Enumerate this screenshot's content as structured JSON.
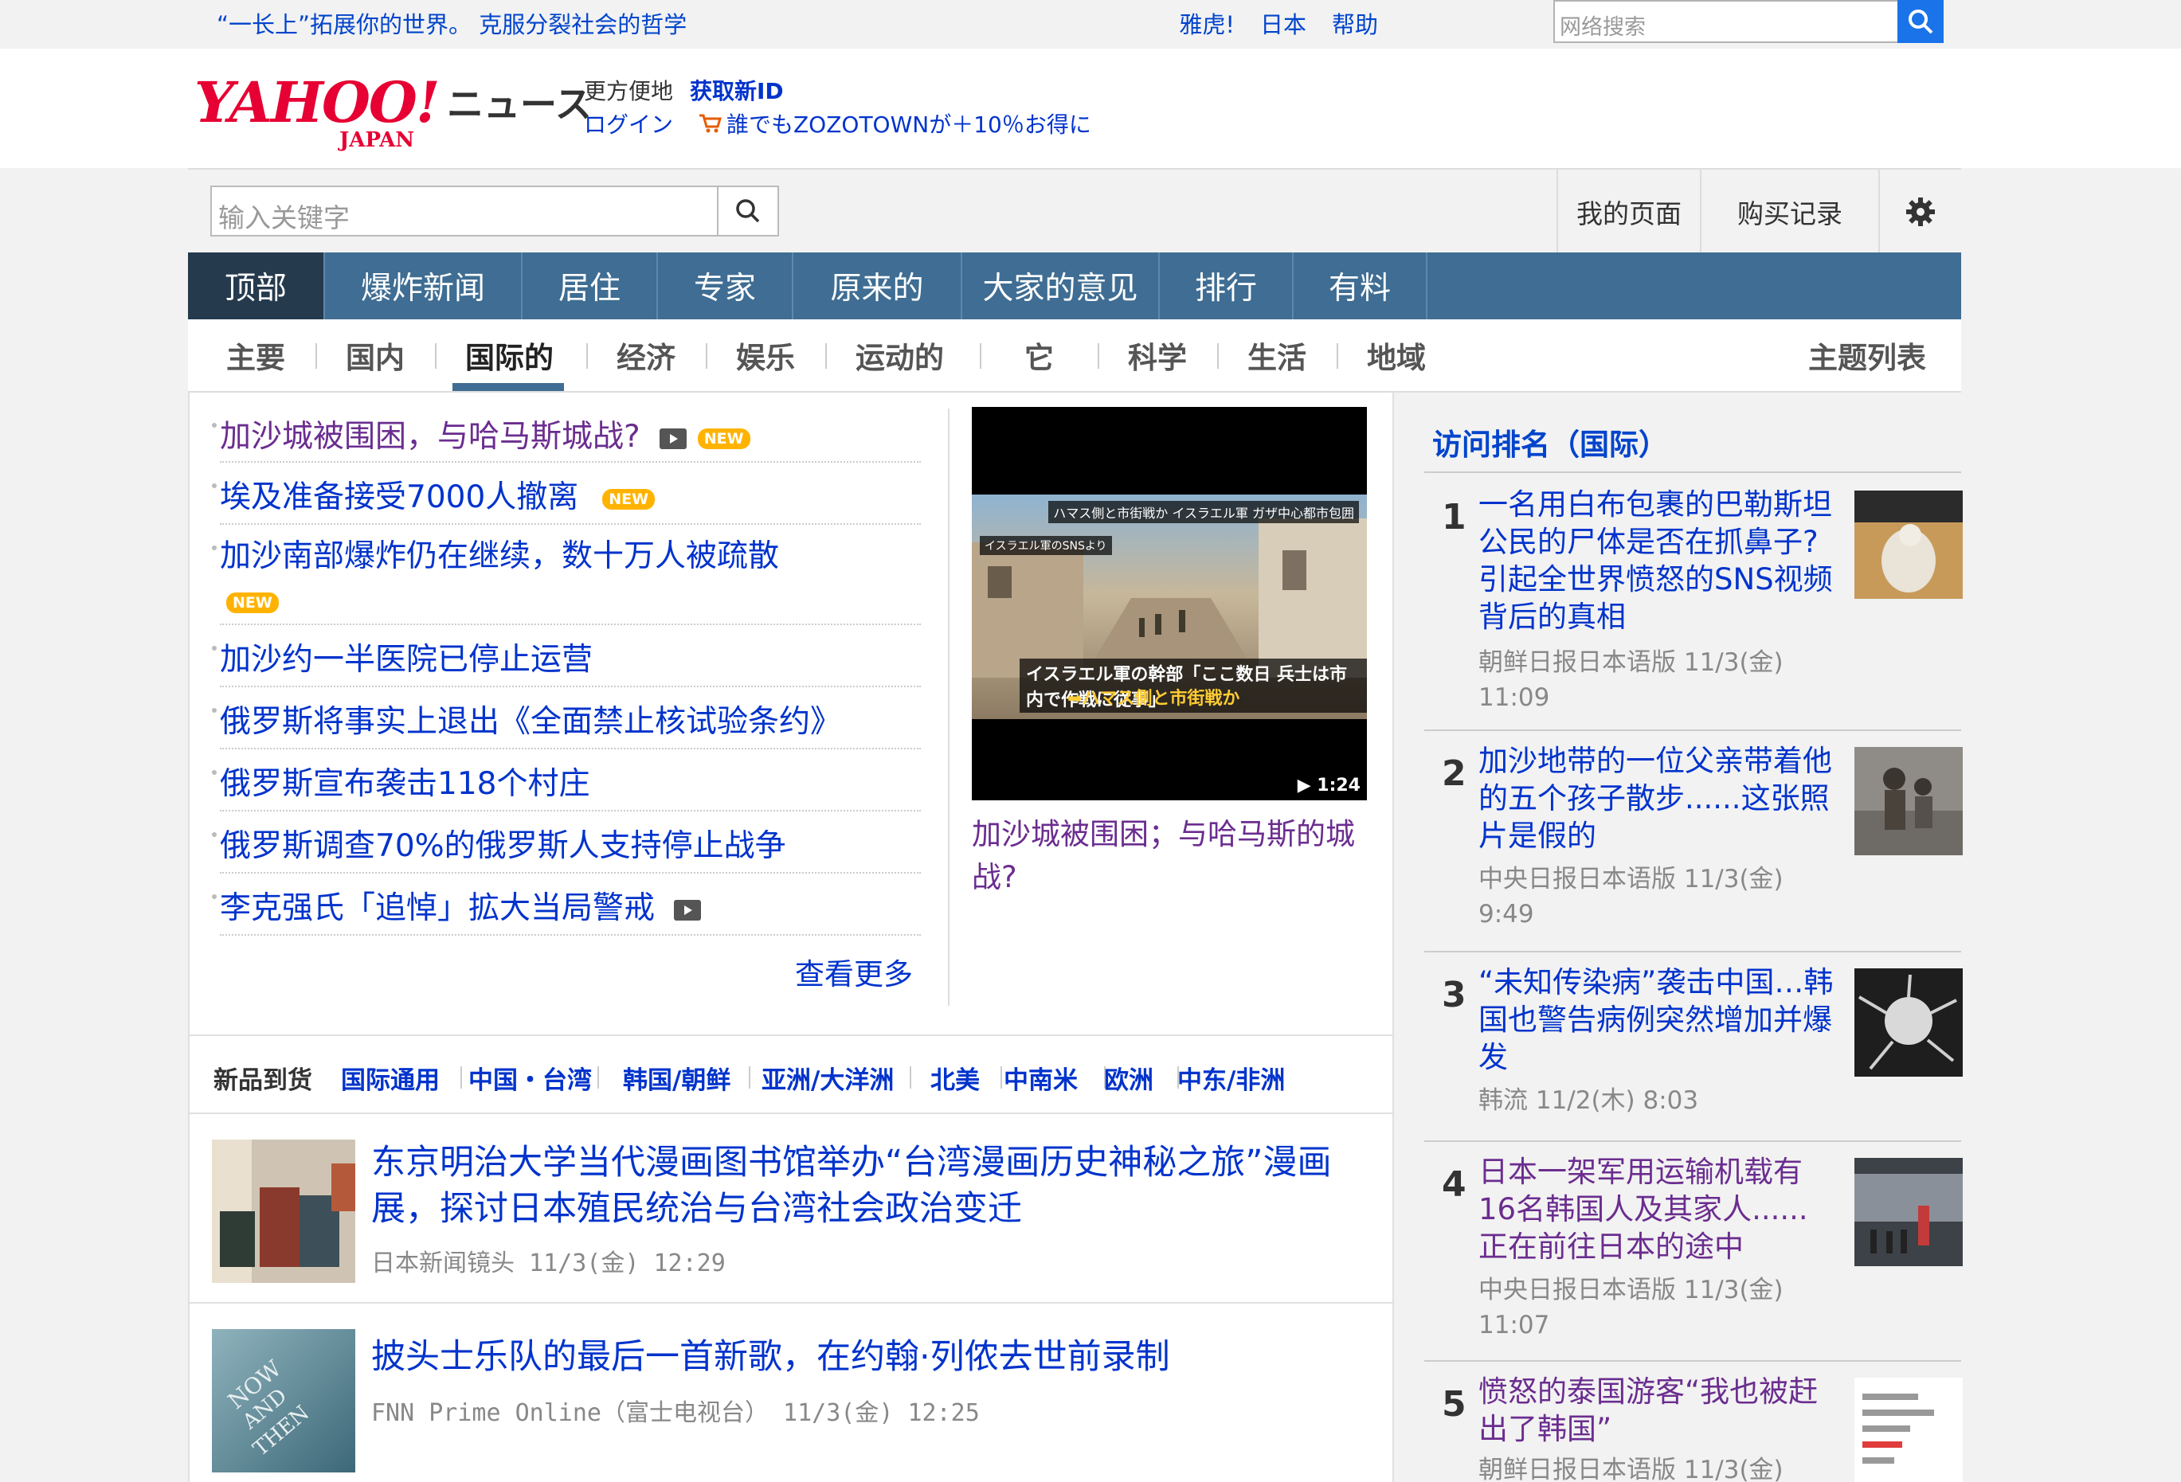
{
  "topbar": {
    "slogan": "“一长上”拓展你的世界。 克服分裂社会的哲学",
    "links": [
      "雅虎!",
      "日本",
      "帮助"
    ],
    "search_placeholder": "网络搜索"
  },
  "header": {
    "logo_yahoo": "YAHOO!",
    "logo_japan": "JAPAN",
    "logo_news": "ニュース",
    "convenient": "更方便地",
    "get_new_id": "获取新ID",
    "login": "ログイン",
    "zozo": "誰でもZOZOTOWNが＋10％お得に"
  },
  "search": {
    "placeholder": "输入关键字",
    "my_page": "我的页面",
    "purchase_history": "购买记录"
  },
  "main_nav": [
    "顶部",
    "爆炸新闻",
    "居住",
    "专家",
    "原来的",
    "大家的意见",
    "排行",
    "有料"
  ],
  "sub_nav": [
    "主要",
    "国内",
    "国际的",
    "经济",
    "娱乐",
    "运动的",
    "它",
    "科学",
    "生活",
    "地域"
  ],
  "topic_list": "主题列表",
  "headlines": [
    {
      "text": "加沙城被围困，与哈马斯城战?",
      "new": "NEW"
    },
    {
      "text": "埃及准备接受7000人撤离",
      "new": "NEW"
    },
    {
      "text": "加沙南部爆炸仍在继续，数十万人被疏散",
      "new": "NEW"
    },
    {
      "text": "加沙约一半医院已停止运营"
    },
    {
      "text": "俄罗斯将事实上退出《全面禁止核试验条约》"
    },
    {
      "text": "俄罗斯宣布袭击118个村庄"
    },
    {
      "text": "俄罗斯调查70%的俄罗斯人支持停止战争"
    },
    {
      "text": "李克强氏「追悼」拡大当局警戒"
    }
  ],
  "see_more": "查看更多",
  "video": {
    "duration": "1:24",
    "caption_tag1": "ハマス側と市街戦か イスラエル軍 ガザ中心都市包囲",
    "caption_tag2": "イスラエル軍のSNSより",
    "caption_line1": "イスラエル軍の幹部「ここ数日 兵士は市内で作戦に従事」",
    "caption_line2": "➡ハマス側と市街戦か",
    "title": "加沙城被围困；与哈马斯的城战?"
  },
  "regions": {
    "label": "新品到货",
    "items": [
      "国际通用",
      "中国・台湾",
      "韩国/朝鲜",
      "亚洲/大洋洲",
      "北美",
      "中南米",
      "欧洲",
      "中东/非洲"
    ]
  },
  "articles": [
    {
      "title": "东京明治大学当代漫画图书馆举办“台湾漫画历史神秘之旅”漫画展，探讨日本殖民统治与台湾社会政治变迁",
      "meta": "日本新闻镜头 11/3(金) 12:29"
    },
    {
      "title": "披头士乐队的最后一首新歌，在约翰·列侬去世前录制",
      "meta": "FNN Prime Online（富士电视台） 11/3(金) 12:25"
    }
  ],
  "ranking": {
    "title": "访问排名（国际）",
    "items": [
      {
        "num": "1",
        "text": "一名用白布包裹的巴勒斯坦公民的尸体是否在抓鼻子?引起全世界愤怒的SNS视频背后的真相",
        "source": "朝鲜日报日本语版 11/3(金) 11:09"
      },
      {
        "num": "2",
        "text": "加沙地带的一位父亲带着他的五个孩子散步......这张照片是假的",
        "source": "中央日报日本语版 11/3(金) 9:49"
      },
      {
        "num": "3",
        "text": "“未知传染病”袭击中国…韩国也警告病例突然增加并爆发",
        "source": "韩流 11/2(木) 8:03"
      },
      {
        "num": "4",
        "text": "日本一架军用运输机载有16名韩国人及其家人......正在前往日本的途中",
        "source": "中央日报日本语版 11/3(金) 11:07"
      },
      {
        "num": "5",
        "text": "愤怒的泰国游客“我也被赶出了韩国”",
        "source": "朝鲜日报日本语版 11/3(金)"
      }
    ]
  },
  "colors": {
    "accent_blue": "#3f6d93",
    "active_tab": "#253a4d",
    "link": "#0033cc",
    "visited": "#6b2d8f",
    "new_badge": "#ffb300",
    "yahoo_red": "#e60033"
  }
}
